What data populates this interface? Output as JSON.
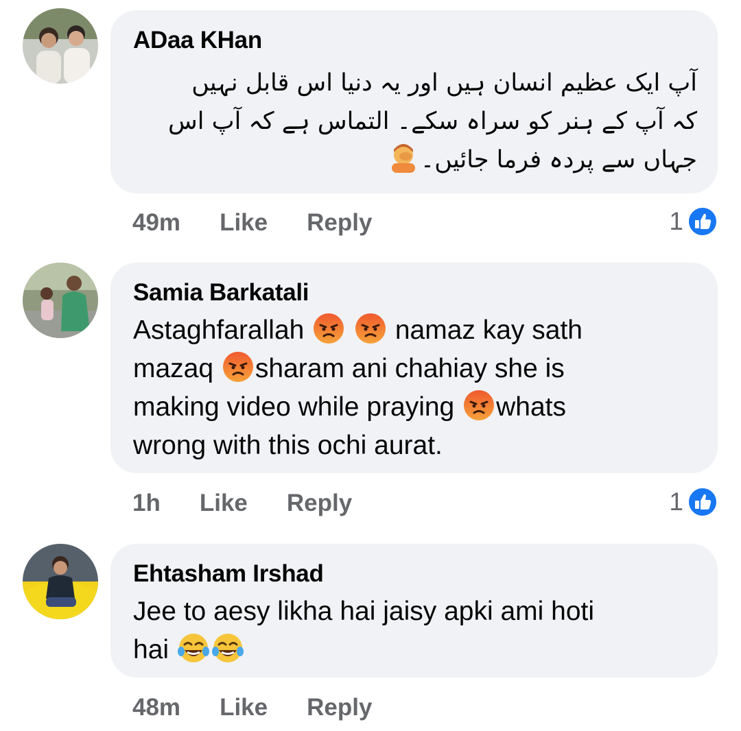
{
  "comments": [
    {
      "author": "ADaa KHan",
      "text_lines": [
        "آپ ایک عظیم انسان ہیں اور یہ دنیا اس قابل نہیں",
        "کہ آپ کے ہنر کو سراہ سکے۔ التماس ہے کہ آپ اس",
        "جہاں سے پردہ فرما جائیں۔"
      ],
      "emoji_icon": "person-facepalming-icon",
      "time": "49m",
      "like_label": "Like",
      "reply_label": "Reply",
      "reaction_count": "1",
      "reaction_icon": "like-reaction-icon"
    },
    {
      "author": "Samia Barkatali",
      "text_parts": [
        "Astaghfarallah ",
        " ",
        " namaz kay sath",
        "mazaq ",
        "sharam ani chahiay she is",
        "making video while praying ",
        "whats",
        "wrong with this ochi aurat."
      ],
      "emoji_icon": "angry-face-icon",
      "time": "1h",
      "like_label": "Like",
      "reply_label": "Reply",
      "reaction_count": "1",
      "reaction_icon": "like-reaction-icon"
    },
    {
      "author": "Ehtasham Irshad",
      "text_parts": [
        "Jee to aesy likha hai jaisy apki ami hoti",
        "hai "
      ],
      "emoji_icon": "tears-of-joy-icon",
      "time": "48m",
      "like_label": "Like",
      "reply_label": "Reply"
    }
  ],
  "colors": {
    "bubble": "#f0f2f5",
    "meta_text": "#65676b",
    "like_blue": "#1877f2",
    "angry_red": "#e9710f"
  }
}
